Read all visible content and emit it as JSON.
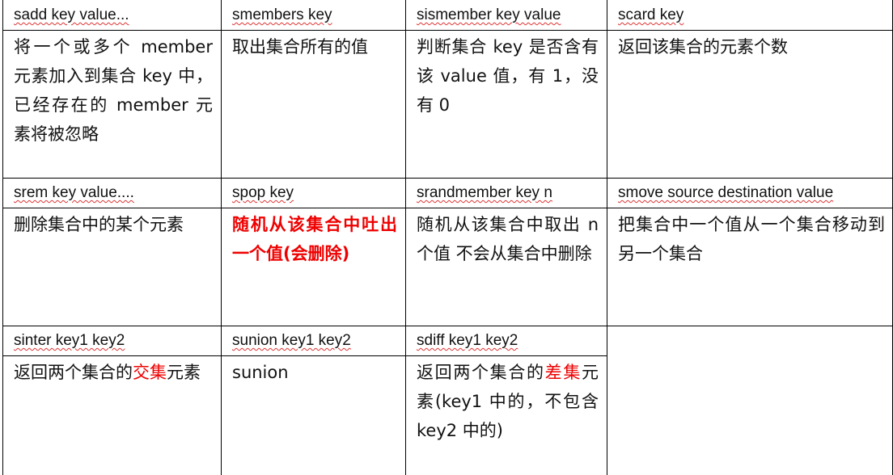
{
  "rows": [
    [
      {
        "cmd": "sadd key value...",
        "pre": "将一个或多个 member 元素加入到集合 key 中，已经存在的 member 元素将被忽略",
        "hl": "",
        "post": ""
      },
      {
        "cmd": "smembers key",
        "pre": "取出集合所有的值",
        "hl": "",
        "post": ""
      },
      {
        "cmd": "sismember key value",
        "pre": "判断集合 key 是否含有该 value 值，有 1，没有 0",
        "hl": "",
        "post": ""
      },
      {
        "cmd": "scard key",
        "pre": "返回该集合的元素个数",
        "hl": "",
        "post": ""
      }
    ],
    [
      {
        "cmd": "srem key value....",
        "pre": "删除集合中的某个元素",
        "hl": "",
        "post": ""
      },
      {
        "cmd": "spop key",
        "pre": "",
        "hl": "随机从该集合中吐出一个值(会删除)",
        "post": ""
      },
      {
        "cmd": "srandmember key n",
        "pre": "随机从该集合中取出 n 个值 不会从集合中删除",
        "hl": "",
        "post": ""
      },
      {
        "cmd": "smove source destination value",
        "pre": "把集合中一个值从一个集合移动到另一个集合",
        "hl": "",
        "post": ""
      }
    ],
    [
      {
        "cmd": "sinter key1 key2",
        "pre": "返回两个集合的",
        "hl": "交集",
        "post": "元素"
      },
      {
        "cmd": "sunion key1 key2",
        "pre": "sunion",
        "hl": "",
        "post": ""
      },
      {
        "cmd": "sdiff key1 key2",
        "pre": "返回两个集合的",
        "hl": "差集",
        "post": "元素(key1 中的，不包含 key2 中的)"
      }
    ]
  ],
  "colors": {
    "highlight": "#ee0000"
  }
}
